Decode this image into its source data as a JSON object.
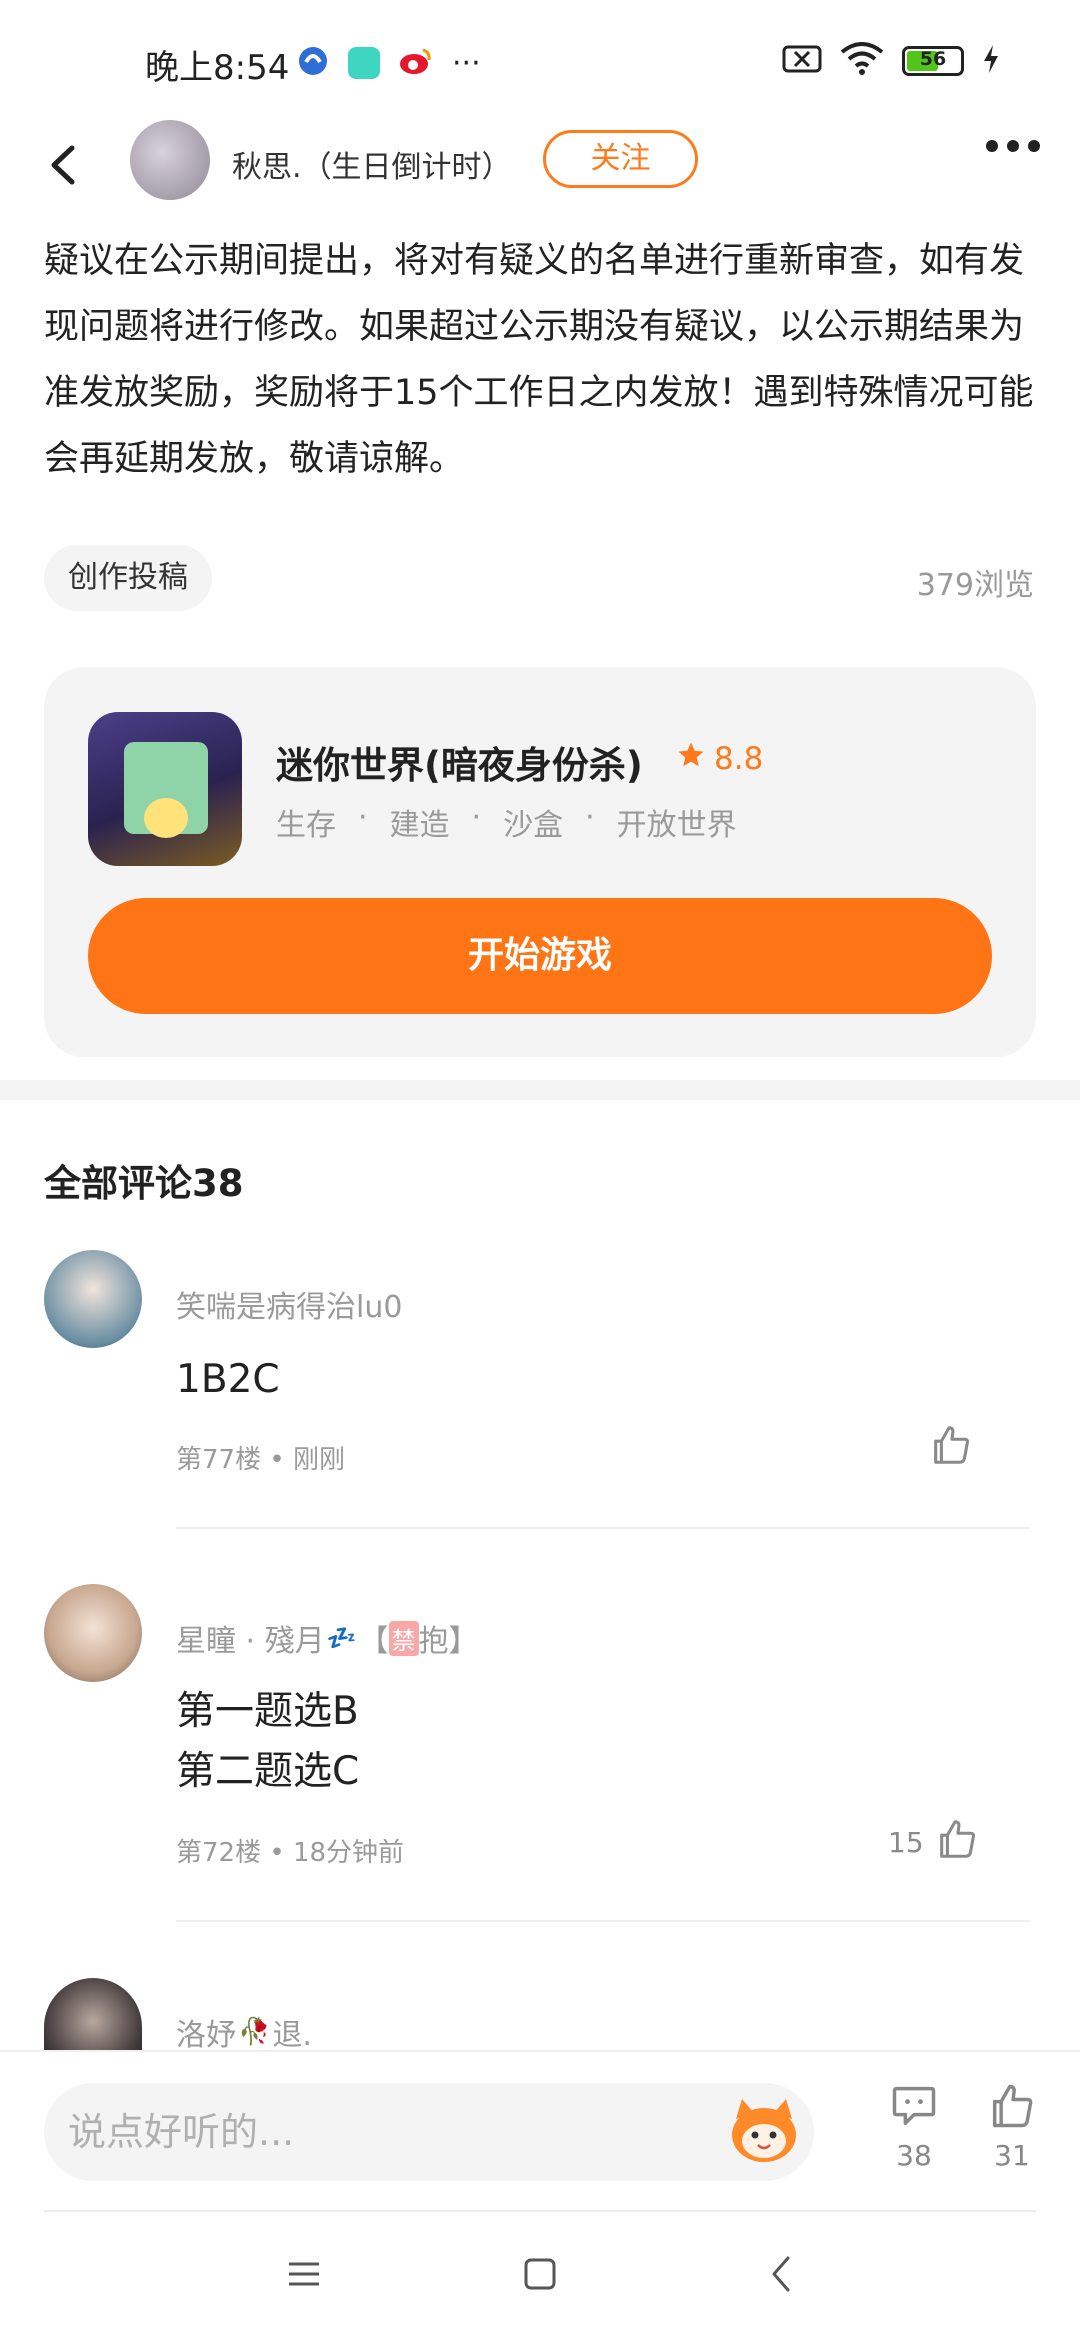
{
  "status_bar": {
    "time": "晚上8:54",
    "overflow": "···",
    "battery_level": "56",
    "colors": {
      "battery_fill": "#52c41a"
    }
  },
  "header": {
    "author": "秋思.（生日倒计时）",
    "follow_label": "关注"
  },
  "article": {
    "text": "疑议在公示期间提出，将对有疑义的名单进行重新审查，如有发现问题将进行修改。如果超过公示期没有疑议，以公示期结果为准发放奖励，奖励将于15个工作日之内发放！遇到特殊情况可能会再延期发放，敬请谅解。",
    "tag": "创作投稿",
    "views": "379浏览"
  },
  "game_card": {
    "title": "迷你世界(暗夜身份杀)",
    "rating": "8.8",
    "tags": [
      "生存",
      "·",
      "建造",
      "·",
      "沙盒",
      "·",
      "开放世界"
    ],
    "start_label": "开始游戏"
  },
  "comments": {
    "title": "全部评论38",
    "items": [
      {
        "name": "笑喘是病得治lu0",
        "text": "1B2C",
        "floor": "第77楼",
        "time": "刚刚",
        "likes": ""
      },
      {
        "name_prefix": "星瞳 · 殘月",
        "name_badge": "禁",
        "name_bracket_l": "【",
        "name_bracket_r": "抱】",
        "text_line1": "第一题选B",
        "text_line2": "第二题选C",
        "floor": "第72楼",
        "time": "18分钟前",
        "likes": "15"
      },
      {
        "name_prefix": "洛妤",
        "name_suffix": "退."
      }
    ]
  },
  "bottom_bar": {
    "input_placeholder": "说点好听的...",
    "comment_count": "38",
    "like_count": "31"
  },
  "colors": {
    "accent": "#ff7516",
    "card_bg": "#f4f4f4"
  }
}
